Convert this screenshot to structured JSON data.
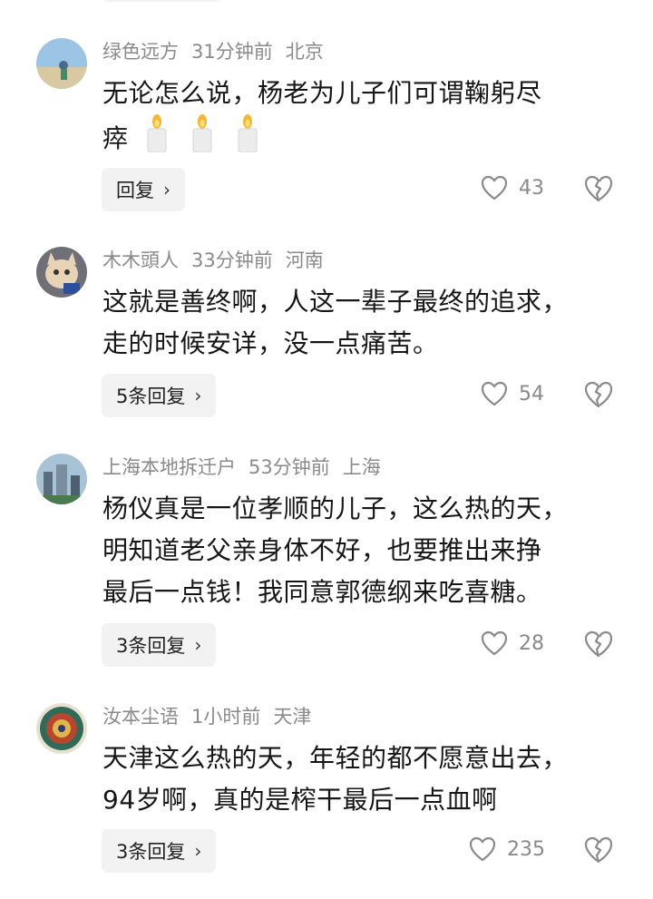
{
  "comments": [
    {
      "username": "绿色远方",
      "time": "31分钟前",
      "location": "北京",
      "text": "无论怎么说，杨老为儿子们可谓鞠躬尽瘁",
      "text_line1": "无论怎么说，杨老为儿子们可谓鞠躬尽",
      "text_line2": "瘁",
      "emoji": "candle-icon x3",
      "reply_label": "回复",
      "likes": "43"
    },
    {
      "username": "木木頭人",
      "time": "33分钟前",
      "location": "河南",
      "text_line1": "这就是善终啊，人这一辈子最终的追求，",
      "text_line2": "走的时候安详，没一点痛苦。",
      "reply_label": "5条回复",
      "likes": "54"
    },
    {
      "username": "上海本地拆迁户",
      "time": "53分钟前",
      "location": "上海",
      "text_line1": "杨仪真是一位孝顺的儿子，这么热的天，",
      "text_line2": "明知道老父亲身体不好，也要推出来挣",
      "text_line3": "最后一点钱！我同意郭德纲来吃喜糖。",
      "reply_label": "3条回复",
      "likes": "28"
    },
    {
      "username": "汝本尘语",
      "time": "1小时前",
      "location": "天津",
      "text_line1": "天津这么热的天，年轻的都不愿意出去，",
      "text_line2": "94岁啊，真的是榨干最后一点血啊",
      "reply_label": "3条回复",
      "likes": "235"
    }
  ],
  "icons": {
    "like": "heart-outline-icon",
    "dislike": "broken-heart-icon",
    "reply_chevron": "chevron-right-icon"
  },
  "colors": {
    "meta_gray": "#8a8a8a",
    "reply_bg": "#f2f2f2",
    "text": "#161616"
  }
}
